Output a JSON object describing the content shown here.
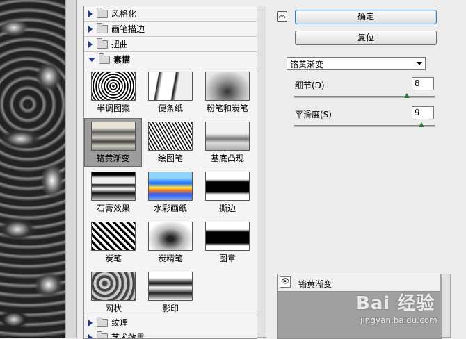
{
  "dialog": {
    "ok_label": "确定",
    "reset_label": "复位"
  },
  "gallery": {
    "categories_top": [
      "风格化",
      "画笔描边",
      "扭曲"
    ],
    "open_category": "素描",
    "thumbnails": [
      "半调图案",
      "便条纸",
      "粉笔和炭笔",
      "铬黄渐变",
      "绘图笔",
      "基底凸现",
      "石膏效果",
      "水彩画纸",
      "撕边",
      "炭笔",
      "炭精笔",
      "图章",
      "网状",
      "影印"
    ],
    "selected_thumbnail": "铬黄渐变",
    "categories_bottom": [
      "纹理",
      "艺术效果"
    ]
  },
  "settings": {
    "filter_select": "铬黄渐变",
    "detail_label": "细节(D)",
    "detail_value": "8",
    "detail_fraction": 0.8,
    "smooth_label": "平滑度(S)",
    "smooth_value": "9",
    "smooth_fraction": 0.9
  },
  "layers": {
    "layer_name": "铬黄渐变"
  },
  "watermark": {
    "text": "Bai 经验",
    "url": "jingyan.baidu.com"
  },
  "icons": {
    "collapse": "double-chevron-up-icon",
    "eye": "eye-icon",
    "folder": "folder-icon"
  }
}
